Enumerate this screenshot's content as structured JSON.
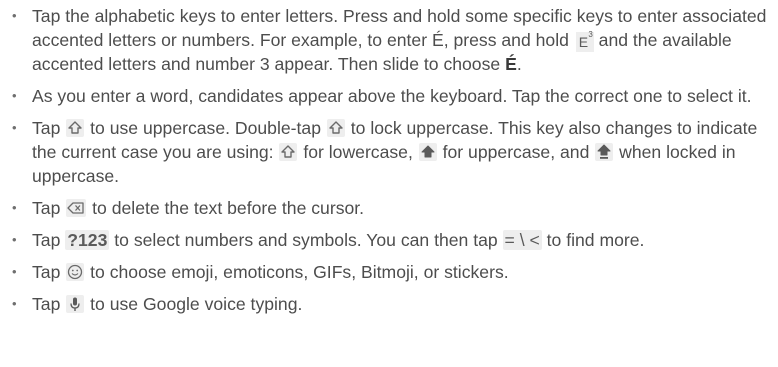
{
  "bullets": {
    "b1": {
      "part1": "Tap the alphabetic keys to enter letters. Press and hold some specific keys to enter associated accented letters or numbers. For example, to enter É, press and hold ",
      "key_main": "E",
      "key_sup": "3",
      "part2": "and the available accented letters and number 3 appear. Then slide to choose ",
      "bold": "É",
      "part3": "."
    },
    "b2": {
      "text": "As you enter a word, candidates appear above the keyboard. Tap the correct one to select it."
    },
    "b3": {
      "t1": "Tap ",
      "t2": " to use uppercase. Double-tap ",
      "t3": " to lock uppercase. This key also changes to indicate the current case you are using: ",
      "t4": " for lowercase, ",
      "t5": " for uppercase, and ",
      "t6": " when locked in uppercase."
    },
    "b4": {
      "t1": "Tap ",
      "t2": " to delete the text before the cursor."
    },
    "b5": {
      "t1": "Tap ",
      "key": "?123",
      "t2": " to select numbers and symbols. You can then tap ",
      "key2": "= \\ <",
      "t3": " to find more."
    },
    "b6": {
      "t1": "Tap ",
      "t2": " to choose emoji, emoticons, GIFs, Bitmoji, or stickers."
    },
    "b7": {
      "t1": "Tap ",
      "t2": " to use Google voice typing."
    }
  },
  "icons": {
    "shift_outline": "shift-outline-icon",
    "shift_filled": "shift-filled-icon",
    "shift_locked": "shift-locked-icon",
    "backspace": "backspace-icon",
    "emoji": "emoji-icon",
    "mic": "mic-icon"
  },
  "colors": {
    "text": "#4d4d4d",
    "key_background": "#eeeeee",
    "icon": "#6a6a6a"
  }
}
